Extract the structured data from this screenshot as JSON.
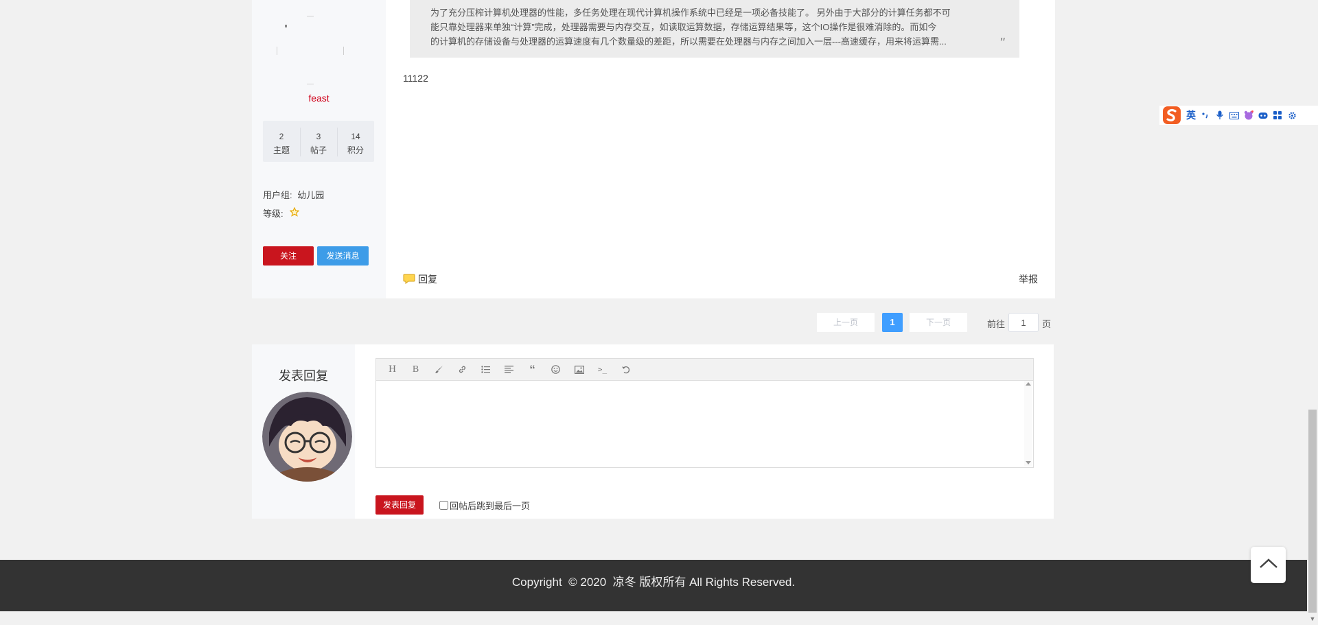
{
  "post": {
    "author": {
      "username": "feast",
      "stats": [
        {
          "value": "2",
          "label": "主题"
        },
        {
          "value": "3",
          "label": "帖子"
        },
        {
          "value": "14",
          "label": "积分"
        }
      ],
      "group_label": "用户组:",
      "group_value": "幼儿园",
      "level_label": "等级:",
      "follow_label": "关注",
      "message_label": "发送消息"
    },
    "quote_lines": [
      "为了充分压榨计算机处理器的性能，多任务处理在现代计算机操作系统中已经是一项必备技能了。 另外由于大部分的计算任务都不可",
      "能只靠处理器来单独“计算”完成，处理器需要与内存交互，如读取运算数据，存储运算结果等，这个IO操作是很难消除的。而如今",
      "的计算机的存储设备与处理器的运算速度有几个数量级的差距，所以需要在处理器与内存之间加入一层---高速缓存，用来将运算需..."
    ],
    "body": "11122",
    "reply_label": "回复",
    "report_label": "举报"
  },
  "pagination": {
    "prev": "上一页",
    "current": "1",
    "next": "下一页",
    "goto_label": "前往",
    "goto_value": "1",
    "page_unit": "页"
  },
  "reply_form": {
    "title": "发表回复",
    "toolbar": [
      "heading-icon",
      "bold-icon",
      "brush-icon",
      "link-icon",
      "list-icon",
      "align-icon",
      "quote-icon",
      "emoji-icon",
      "image-icon",
      "code-icon",
      "undo-icon"
    ],
    "submit_label": "发表回复",
    "jump_label": "回帖后跳到最后一页"
  },
  "footer": {
    "copyright": "Copyright  © 2020  凉冬 版权所有 All Rights Reserved."
  },
  "ime": {
    "mode": "英"
  },
  "colors": {
    "accent_red": "#c9151e",
    "accent_blue": "#409eff",
    "username_red": "#d0021b",
    "footer_bg": "#333333"
  }
}
